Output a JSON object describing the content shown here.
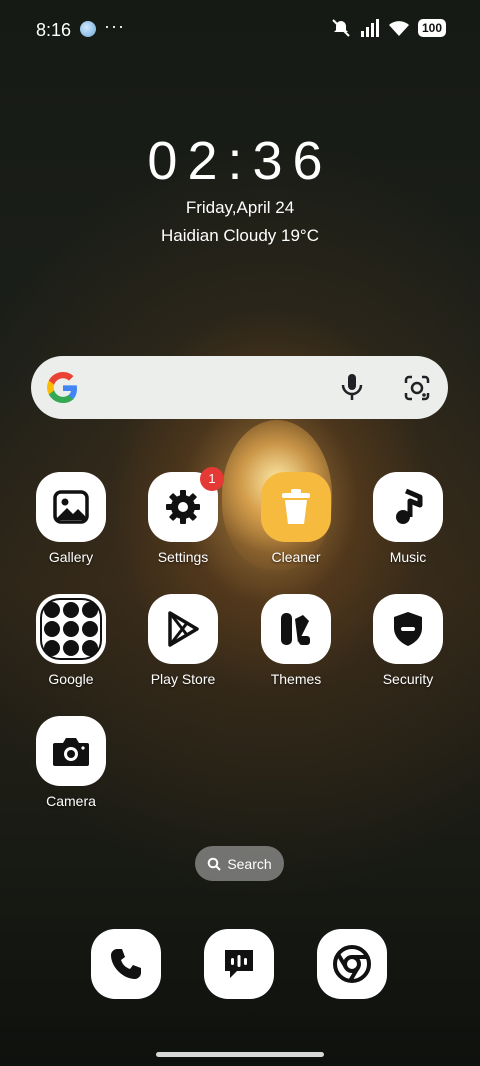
{
  "status_bar": {
    "time": "8:16",
    "dots": "···",
    "battery": "100"
  },
  "clock_widget": {
    "time": "02:36",
    "date": "Friday,April 24",
    "weather": "Haidian Cloudy 19°C"
  },
  "search_widget": {
    "icons": [
      "google-logo-icon",
      "microphone-icon",
      "google-lens-icon"
    ]
  },
  "apps": [
    {
      "label": "Gallery",
      "icon": "gallery-icon"
    },
    {
      "label": "Settings",
      "icon": "gear-icon",
      "badge": "1"
    },
    {
      "label": "Cleaner",
      "icon": "trash-icon"
    },
    {
      "label": "Music",
      "icon": "music-note-icon"
    },
    {
      "label": "Google",
      "icon": "folder-icon"
    },
    {
      "label": "Play Store",
      "icon": "play-store-icon"
    },
    {
      "label": "Themes",
      "icon": "themes-icon"
    },
    {
      "label": "Security",
      "icon": "shield-icon"
    },
    {
      "label": "Camera",
      "icon": "camera-icon"
    }
  ],
  "app_search": {
    "label": "Search"
  },
  "dock": [
    {
      "icon": "phone-icon"
    },
    {
      "icon": "messages-icon"
    },
    {
      "icon": "chrome-icon"
    }
  ],
  "colors": {
    "badge": "#e53935",
    "cleaner": "#f6ba3f",
    "search_bg": "#eceeec"
  }
}
